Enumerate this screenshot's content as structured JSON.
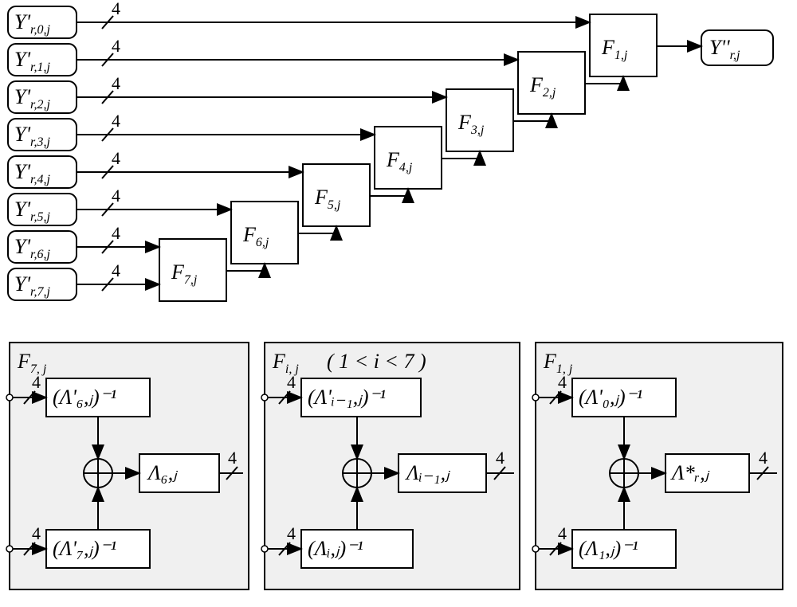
{
  "diagram": {
    "bus_width": "4",
    "inputs": [
      {
        "var": "Y'",
        "sub": "r,0,j"
      },
      {
        "var": "Y'",
        "sub": "r,1,j"
      },
      {
        "var": "Y'",
        "sub": "r,2,j"
      },
      {
        "var": "Y'",
        "sub": "r,3,j"
      },
      {
        "var": "Y'",
        "sub": "r,4,j"
      },
      {
        "var": "Y'",
        "sub": "r,5,j"
      },
      {
        "var": "Y'",
        "sub": "r,6,j"
      },
      {
        "var": "Y'",
        "sub": "r,7,j"
      }
    ],
    "fblocks": [
      {
        "var": "F",
        "sub": "7,j"
      },
      {
        "var": "F",
        "sub": "6,j"
      },
      {
        "var": "F",
        "sub": "5,j"
      },
      {
        "var": "F",
        "sub": "4,j"
      },
      {
        "var": "F",
        "sub": "3,j"
      },
      {
        "var": "F",
        "sub": "2,j"
      },
      {
        "var": "F",
        "sub": "1,j"
      }
    ],
    "output": {
      "var": "Y''",
      "sub": "r,j"
    },
    "detail_panels": [
      {
        "title_var": "F",
        "title_sub": "7, j",
        "title_note": "",
        "top_box": "(Λ'₆,ⱼ)⁻¹",
        "bot_box": "(Λ'₇,ⱼ)⁻¹",
        "out_box": "Λ₆,ⱼ"
      },
      {
        "title_var": "F",
        "title_sub": "i, j",
        "title_note": "( 1 < i < 7 )",
        "top_box": "(Λ'ᵢ₋₁,ⱼ)⁻¹",
        "bot_box": "(Λᵢ,ⱼ)⁻¹",
        "out_box": "Λᵢ₋₁,ⱼ"
      },
      {
        "title_var": "F",
        "title_sub": "1, j",
        "title_note": "",
        "top_box": "(Λ'₀,ⱼ)⁻¹",
        "bot_box": "(Λ₁,ⱼ)⁻¹",
        "out_box": "Λ*ᵣ,ⱼ"
      }
    ]
  }
}
